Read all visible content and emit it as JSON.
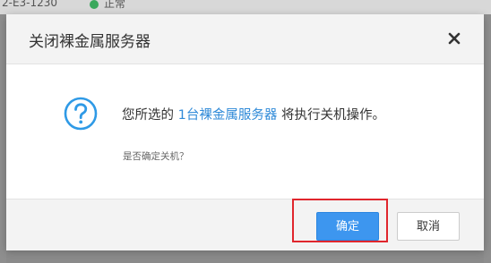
{
  "background": {
    "server_id": "2-E3-1230",
    "status_text": "正常"
  },
  "dialog": {
    "title": "关闭裸金属服务器",
    "close_icon": "close-icon",
    "message_prefix": "您所选的 ",
    "message_link": "1台裸金属服务器",
    "message_suffix": " 将执行关机操作。",
    "sub_message": "是否确定关机？",
    "confirm_label": "确定",
    "cancel_label": "取消"
  },
  "colors": {
    "accent": "#3d96ef",
    "link": "#2f8ad8",
    "highlight": "#e0262d",
    "status_ok": "#3aa85c"
  }
}
